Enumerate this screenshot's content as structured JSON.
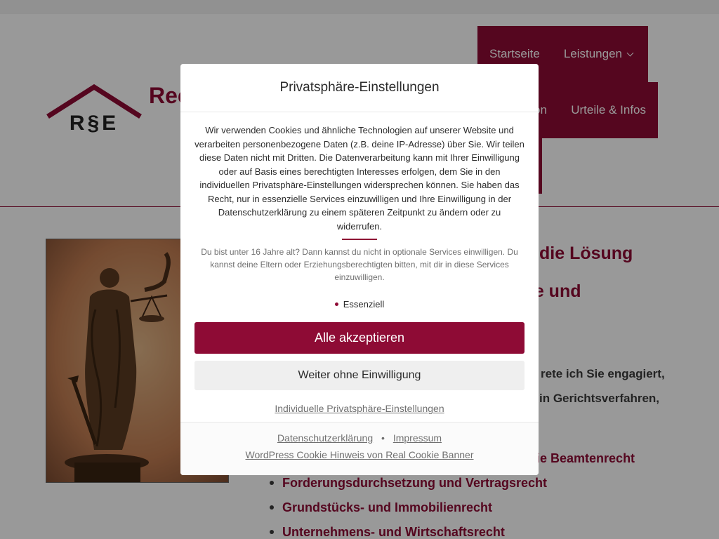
{
  "site": {
    "title_visible": "Rec",
    "logo_text": "R§E"
  },
  "nav": {
    "items": [
      {
        "label": "Startseite"
      },
      {
        "label": "Leistungen"
      },
      {
        "label": "on"
      },
      {
        "label": "Urteile & Infos"
      }
    ]
  },
  "content": {
    "heading_1": "die Lösung",
    "heading_2": "tze und",
    "para_1": "rete ich Sie engagiert,",
    "para_2": "in Gerichtsverfahren,",
    "list": [
      "ie Beamtenrecht",
      "Forderungsdurchsetzung und Vertragsrecht",
      "Grundstücks- und Immobilienrecht",
      "Unternehmens- und Wirtschaftsrecht"
    ]
  },
  "cookie_dialog": {
    "title": "Privatsphäre-Einstellungen",
    "intro": "Wir verwenden Cookies und ähnliche Technologien auf unserer Website und verarbeiten personenbezogene Daten (z.B. deine IP-Adresse) über Sie. Wir teilen diese Daten nicht mit Dritten. Die Datenverarbeitung kann mit Ihrer Einwilligung oder auf Basis eines berechtigten Interesses erfolgen, dem Sie in den individuellen Privatsphäre-Einstellungen widersprechen können. Sie haben das Recht, nur in essenzielle Services einzuwilligen und Ihre Einwilligung in der Datenschutzerklärung zu einem späteren Zeitpunkt zu ändern oder zu widerrufen.",
    "age_notice": "Du bist unter 16 Jahre alt? Dann kannst du nicht in optionale Services einwilligen. Du kannst deine Eltern oder Erziehungsberechtigten bitten, mit dir in diese Services einzuwilligen.",
    "group_label": "Essenziell",
    "accept_all": "Alle akzeptieren",
    "continue_without": "Weiter ohne Einwilligung",
    "individual_settings": "Individuelle Privatsphäre-Einstellungen",
    "footer": {
      "privacy_link": "Datenschutzerklärung",
      "separator": "•",
      "imprint_link": "Impressum",
      "banner_credit": "WordPress Cookie Hinweis von Real Cookie Banner"
    }
  },
  "colors": {
    "brand": "#8e0b35",
    "overlay": "rgba(0,0,0,0.4)"
  }
}
